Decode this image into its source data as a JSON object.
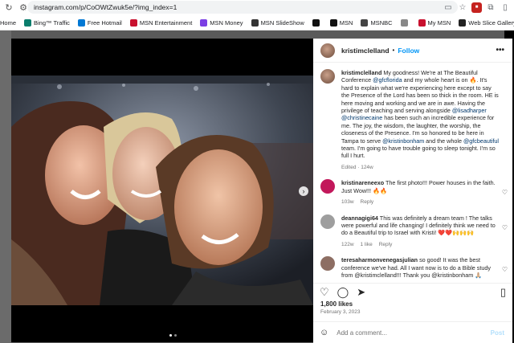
{
  "browser": {
    "url": "instagram.com/p/CoOWtZwuk5e/?img_index=1",
    "bookmarks": [
      {
        "label": "Home",
        "color": "#ffffff"
      },
      {
        "label": "Bing™ Traffic",
        "color": "#0a7d6c"
      },
      {
        "label": "Free Hotmail",
        "color": "#0078d4"
      },
      {
        "label": "MSN Entertainment",
        "color": "#c8102e"
      },
      {
        "label": "MSN Money",
        "color": "#7b3fe4"
      },
      {
        "label": "MSN SlideShow",
        "color": "#333333"
      },
      {
        "label": "",
        "color": "#111111"
      },
      {
        "label": "MSN",
        "color": "#111111"
      },
      {
        "label": "MSNBC",
        "color": "#444444"
      },
      {
        "label": "",
        "color": "#888888"
      },
      {
        "label": "My MSN",
        "color": "#c8102e"
      },
      {
        "label": "Web Slice Gallery",
        "color": "#222222"
      }
    ]
  },
  "post": {
    "username": "kristimclelland",
    "follow": "Follow",
    "more": "•••",
    "caption_user": "kristimclelland",
    "caption_parts": [
      {
        "t": " My goodness! We're at The Beautiful Conference ",
        "c": ""
      },
      {
        "t": "@gfcflorida",
        "c": "blue"
      },
      {
        "t": " and my whole heart is on 🔥. It's hard to explain what we're experiencing here except to say the Presence of the Lord has been so thick in the room. HE is here moving and working and we are in awe. Having the privilege of teaching and serving alongside ",
        "c": ""
      },
      {
        "t": "@lisadharper",
        "c": "blue"
      },
      {
        "t": " ",
        "c": ""
      },
      {
        "t": "@christinecaine",
        "c": "blue"
      },
      {
        "t": " has been such an incredible experience for me. The joy, the wisdom, the laughter, the worship, the closeness of the Presence. I'm so honored to be here in Tampa to serve ",
        "c": ""
      },
      {
        "t": "@kristinbonham",
        "c": "blue"
      },
      {
        "t": " and the whole ",
        "c": ""
      },
      {
        "t": "@gfcbeautiful",
        "c": "blue"
      },
      {
        "t": " team. I'm going to have trouble going to sleep tonight. I'm so full I hurt.",
        "c": ""
      }
    ],
    "caption_meta": "Edited · 124w",
    "comments": [
      {
        "user": "kristinareneexo",
        "text": " The first photo!!! Power houses in the faith. Just Wow!!! 🔥🔥",
        "time": "103w",
        "likes": "",
        "reply": "Reply",
        "avatar": "#c2185b"
      },
      {
        "user": "deannagigi64",
        "text": " This was definitely a dream team ! The talks were powerful and life changing! I definitely think we need to do a Beautiful trip to Israel with Kristi! ❤️❤️🙌🙌🙌",
        "time": "122w",
        "likes": "1 like",
        "reply": "Reply",
        "avatar": "#9e9e9e"
      },
      {
        "user": "teresaharmonvenegasjulian",
        "text": " so good! It was the best conference we've had. All I want now is to do a Bible study from @kristimclelland!!! Thank you @kristinbonham 🙏🏼",
        "time": "123w",
        "likes": "1 like",
        "reply": "Reply",
        "avatar": "#8d6e63"
      }
    ],
    "likes": "1,800 likes",
    "date": "February 3, 2023",
    "add_comment": "Add a comment...",
    "post_label": "Post"
  }
}
